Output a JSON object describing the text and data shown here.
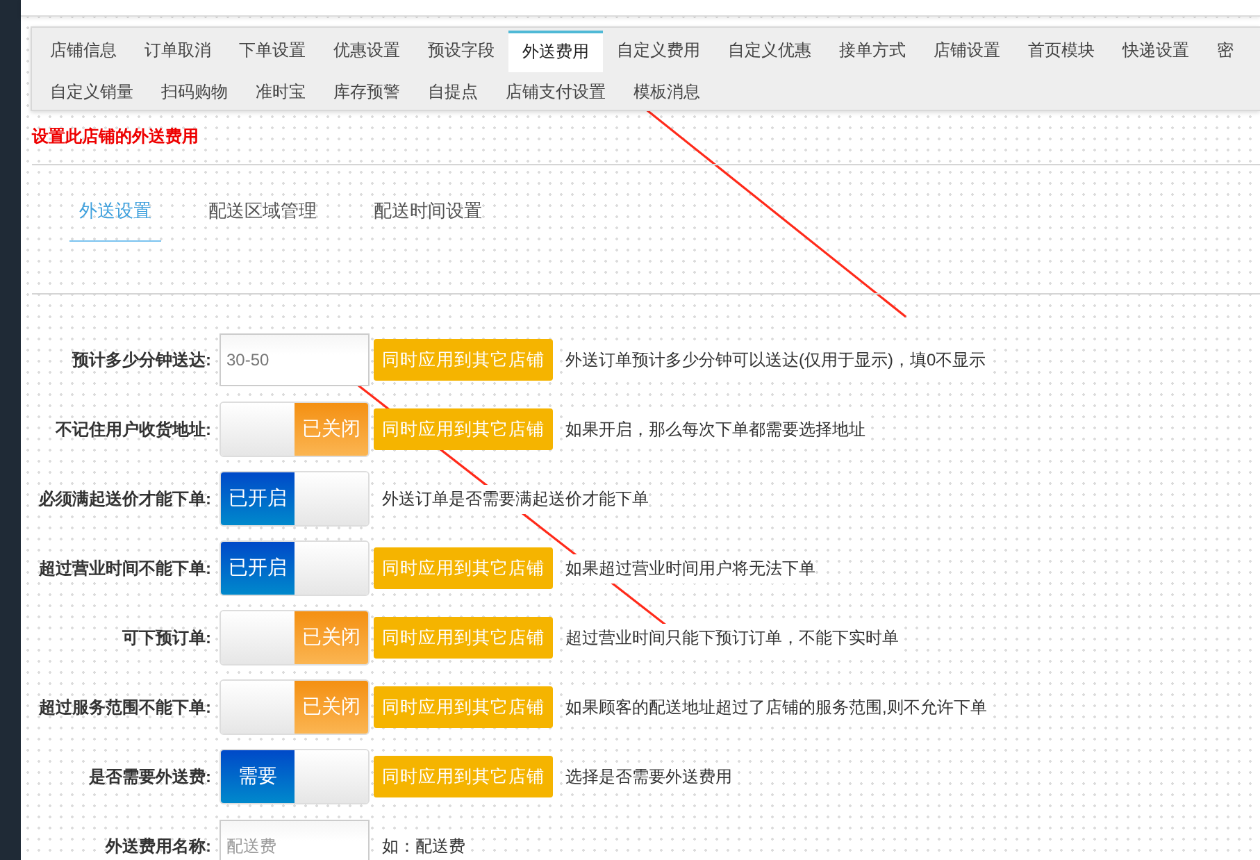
{
  "top_tabs": [
    {
      "label": "店铺信息",
      "selected": false
    },
    {
      "label": "订单取消",
      "selected": false
    },
    {
      "label": "下单设置",
      "selected": false
    },
    {
      "label": "优惠设置",
      "selected": false
    },
    {
      "label": "预设字段",
      "selected": false
    },
    {
      "label": "外送费用",
      "selected": true
    },
    {
      "label": "自定义费用",
      "selected": false
    },
    {
      "label": "自定义优惠",
      "selected": false
    },
    {
      "label": "接单方式",
      "selected": false
    },
    {
      "label": "店铺设置",
      "selected": false
    },
    {
      "label": "首页模块",
      "selected": false
    },
    {
      "label": "快递设置",
      "selected": false
    },
    {
      "label": "密",
      "selected": false
    },
    {
      "label": "自定义销量",
      "selected": false
    },
    {
      "label": "扫码购物",
      "selected": false
    },
    {
      "label": "准时宝",
      "selected": false
    },
    {
      "label": "库存预警",
      "selected": false
    },
    {
      "label": "自提点",
      "selected": false
    },
    {
      "label": "店铺支付设置",
      "selected": false
    },
    {
      "label": "模板消息",
      "selected": false
    }
  ],
  "notice": "设置此店铺的外送费用",
  "sub_tabs": [
    {
      "label": "外送设置",
      "selected": true
    },
    {
      "label": "配送区域管理",
      "selected": false
    },
    {
      "label": "配送时间设置",
      "selected": false
    }
  ],
  "fields": [
    {
      "kind": "input",
      "label": "预计多少分钟送达:",
      "value": "30-50",
      "apply_button": "同时应用到其它店铺",
      "help": "外送订单预计多少分钟可以送达(仅用于显示)，填0不显示"
    },
    {
      "kind": "switch",
      "label": "不记住用户收货地址:",
      "on": false,
      "switch_text": "已关闭",
      "apply_button": "同时应用到其它店铺",
      "help": "如果开启，那么每次下单都需要选择地址"
    },
    {
      "kind": "switch",
      "label": "必须满起送价才能下单:",
      "on": true,
      "switch_text": "已开启",
      "help": "外送订单是否需要满起送价才能下单"
    },
    {
      "kind": "switch",
      "label": "超过营业时间不能下单:",
      "on": true,
      "switch_text": "已开启",
      "apply_button": "同时应用到其它店铺",
      "help": "如果超过营业时间用户将无法下单"
    },
    {
      "kind": "switch",
      "label": "可下预订单:",
      "on": false,
      "switch_text": "已关闭",
      "apply_button": "同时应用到其它店铺",
      "help": "超过营业时间只能下预订订单，不能下实时单"
    },
    {
      "kind": "switch",
      "label": "超过服务范围不能下单:",
      "on": false,
      "switch_text": "已关闭",
      "apply_button": "同时应用到其它店铺",
      "help": "如果顾客的配送地址超过了店铺的服务范围,则不允许下单"
    },
    {
      "kind": "switch",
      "label": "是否需要外送费:",
      "on": true,
      "switch_text": "需要",
      "apply_button": "同时应用到其它店铺",
      "help": "选择是否需要外送费用"
    },
    {
      "kind": "input",
      "label": "外送费用名称:",
      "placeholder": "配送费",
      "help": "如：配送费"
    }
  ]
}
